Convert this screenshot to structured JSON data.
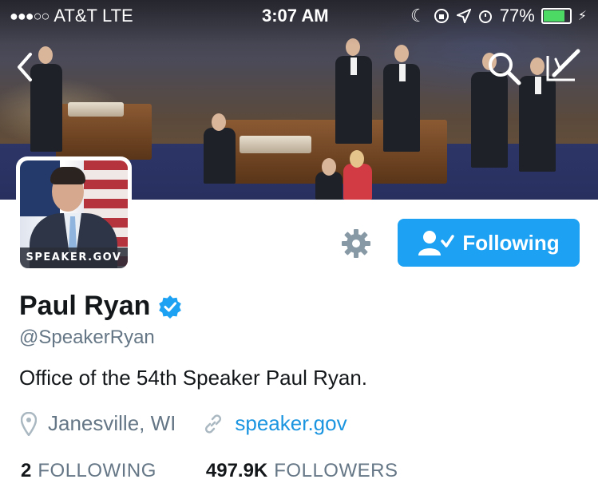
{
  "status_bar": {
    "carrier": "AT&T",
    "network": "LTE",
    "time": "3:07 AM",
    "battery": "77%",
    "battery_level": 0.77
  },
  "profile": {
    "name": "Paul Ryan",
    "handle": "@SpeakerRyan",
    "bio": "Office of the 54th Speaker Paul Ryan.",
    "location": "Janesville, WI",
    "website": "speaker.gov",
    "avatar_banner": "SPEAKER.GOV"
  },
  "actions": {
    "following_label": "Following"
  },
  "stats": {
    "following_count": "2",
    "following_label": "FOLLOWING",
    "followers_count": "497.9K",
    "followers_label": "FOLLOWERS"
  },
  "colors": {
    "accent": "#1da1f2",
    "link": "#1b95e0",
    "verified": "#1da1f2",
    "secondary_text": "#657786"
  },
  "icons": [
    "back-chevron-icon",
    "search-icon",
    "compose-tweet-icon",
    "gear-icon",
    "follow-user-check-icon",
    "verified-badge-icon",
    "location-pin-icon",
    "link-icon"
  ]
}
